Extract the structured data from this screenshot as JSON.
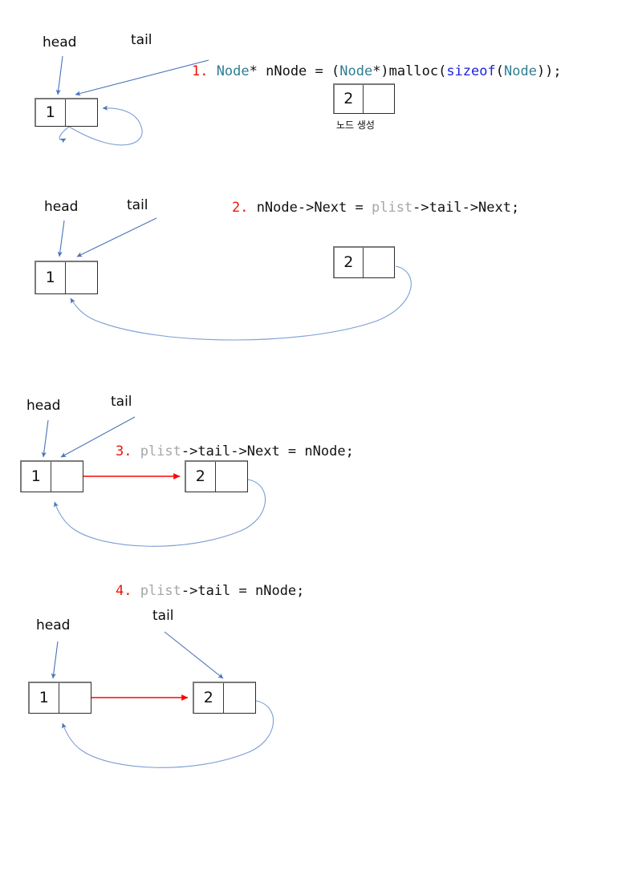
{
  "document": {
    "title": "Linked list append — step by step",
    "background": "#ffffff",
    "colors": {
      "step_number": "#e8160c",
      "type_keyword": "#2f7f92",
      "sizeof_keyword": "#1b22e0",
      "dim_identifier": "#a6a6a6",
      "pointer_arrow": "#4a74b8",
      "next_link_arrow": "#fb0606",
      "node_border": "#2b2b2b",
      "node_shadow_border": "#7a7a7a",
      "text": "#111111"
    }
  },
  "steps": [
    {
      "id": "step-1",
      "number": "1.",
      "code_tokens": [
        {
          "text": "Node",
          "style": "kw"
        },
        {
          "text": "* nNode = (",
          "style": "pl"
        },
        {
          "text": "Node",
          "style": "kw"
        },
        {
          "text": "*)malloc(",
          "style": "pl"
        },
        {
          "text": "sizeof",
          "style": "sz"
        },
        {
          "text": "(",
          "style": "pl"
        },
        {
          "text": "Node",
          "style": "kw"
        },
        {
          "text": "));",
          "style": "pl"
        }
      ],
      "code_plain": "1. Node* nNode = (Node*)malloc(sizeof(Node));",
      "labels": {
        "head": "head",
        "tail": "tail"
      },
      "nodes": [
        {
          "name": "list-node-1",
          "value": "1"
        },
        {
          "name": "new-node-2",
          "value": "2"
        }
      ],
      "caption": "노드 생성"
    },
    {
      "id": "step-2",
      "number": "2.",
      "code_tokens": [
        {
          "text": "nNode->Next = ",
          "style": "pl"
        },
        {
          "text": "plist",
          "style": "dim"
        },
        {
          "text": "->tail->Next;",
          "style": "pl"
        }
      ],
      "code_plain": "2. nNode->Next = plist->tail->Next;",
      "labels": {
        "head": "head",
        "tail": "tail"
      },
      "nodes": [
        {
          "name": "list-node-1",
          "value": "1"
        },
        {
          "name": "new-node-2",
          "value": "2"
        }
      ],
      "caption": ""
    },
    {
      "id": "step-3",
      "number": "3.",
      "code_tokens": [
        {
          "text": "plist",
          "style": "dim"
        },
        {
          "text": "->tail->Next = nNode;",
          "style": "pl"
        }
      ],
      "code_plain": "3. plist->tail->Next = nNode;",
      "labels": {
        "head": "head",
        "tail": "tail"
      },
      "nodes": [
        {
          "name": "list-node-1",
          "value": "1"
        },
        {
          "name": "new-node-2",
          "value": "2"
        }
      ],
      "caption": ""
    },
    {
      "id": "step-4",
      "number": "4.",
      "code_tokens": [
        {
          "text": "plist",
          "style": "dim"
        },
        {
          "text": "->tail = nNode;",
          "style": "pl"
        }
      ],
      "code_plain": "4. plist->tail = nNode;",
      "labels": {
        "head": "head",
        "tail": "tail"
      },
      "nodes": [
        {
          "name": "list-node-1",
          "value": "1"
        },
        {
          "name": "new-node-2",
          "value": "2"
        }
      ],
      "caption": ""
    }
  ]
}
